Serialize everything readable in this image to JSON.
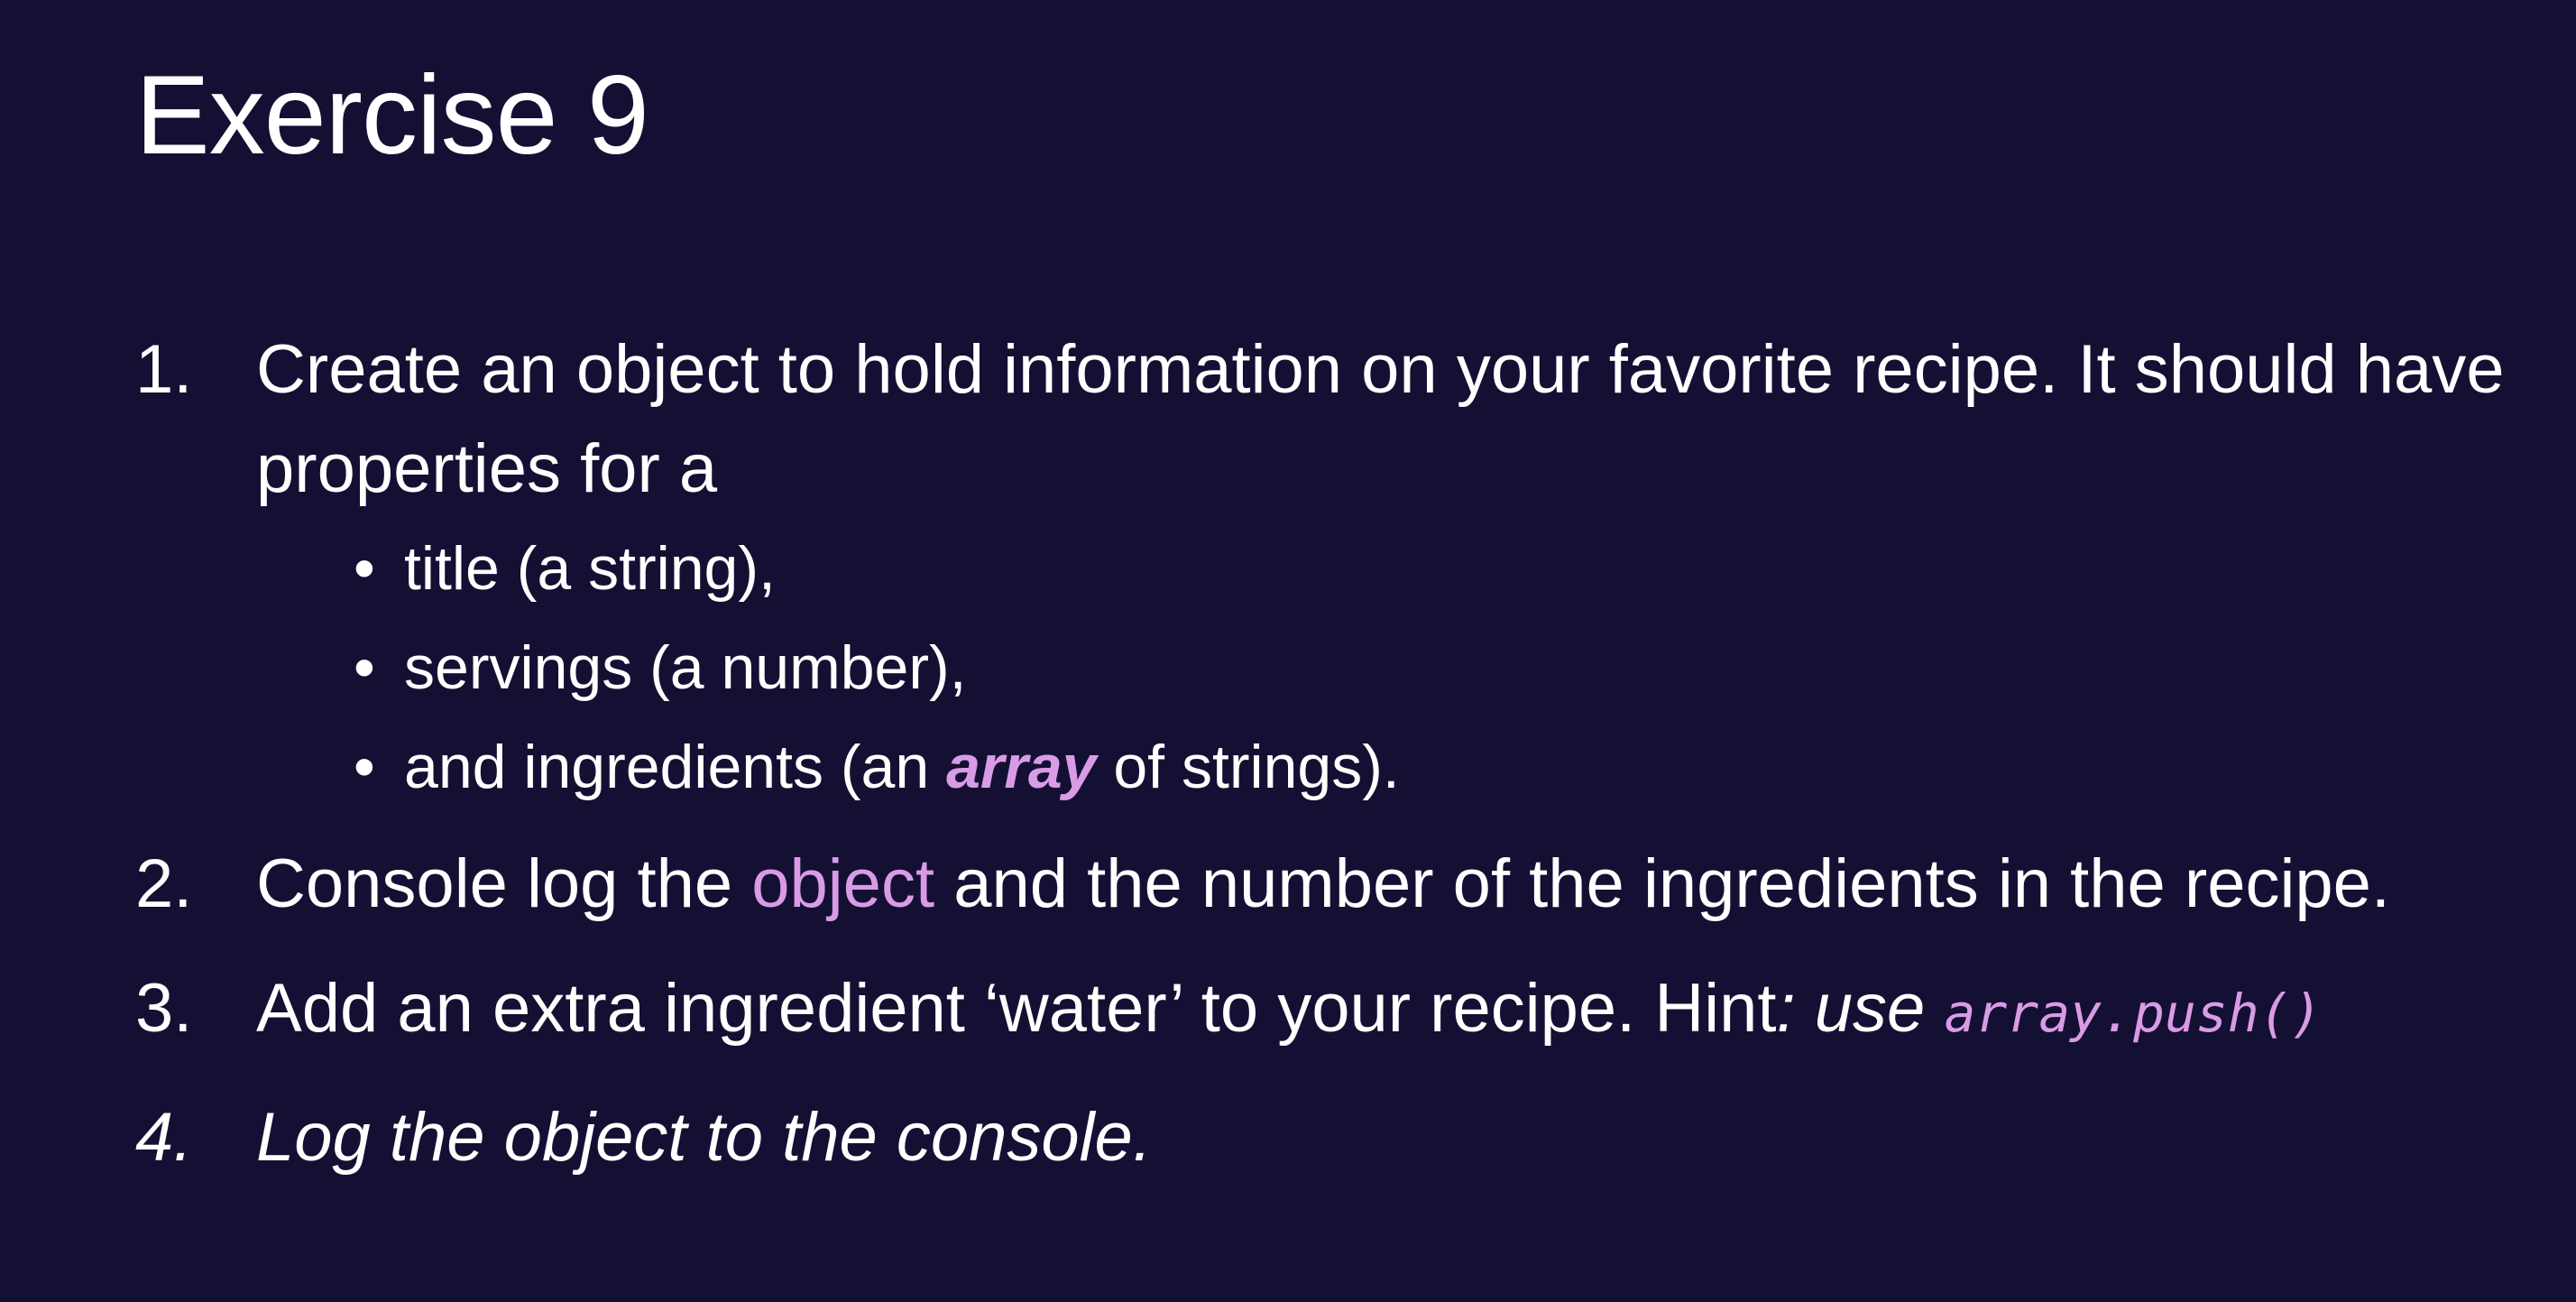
{
  "slide": {
    "title": "Exercise 9",
    "accent_color": "#d99be6",
    "background_color": "#141033",
    "items": [
      {
        "number": "1.",
        "text_line": "Create an object to hold information on your favorite recipe. It should have properties for a",
        "subitems": [
          {
            "bullet": "•",
            "text": "title (a string),"
          },
          {
            "bullet": "•",
            "text": "servings (a number),"
          },
          {
            "bullet": "•",
            "pre": "and ingredients (an ",
            "emph": "array",
            "post": " of strings)."
          }
        ]
      },
      {
        "number": "2.",
        "pre": "Console log the ",
        "highlight": "object",
        "post": " and the number of the ingredients in the recipe."
      },
      {
        "number": "3.",
        "pre": "Add an extra ingredient ‘water’ to your recipe. Hint",
        "italic": ": use ",
        "code": "array.push()"
      },
      {
        "number": "4.",
        "text": "Log the object to the console."
      }
    ]
  }
}
